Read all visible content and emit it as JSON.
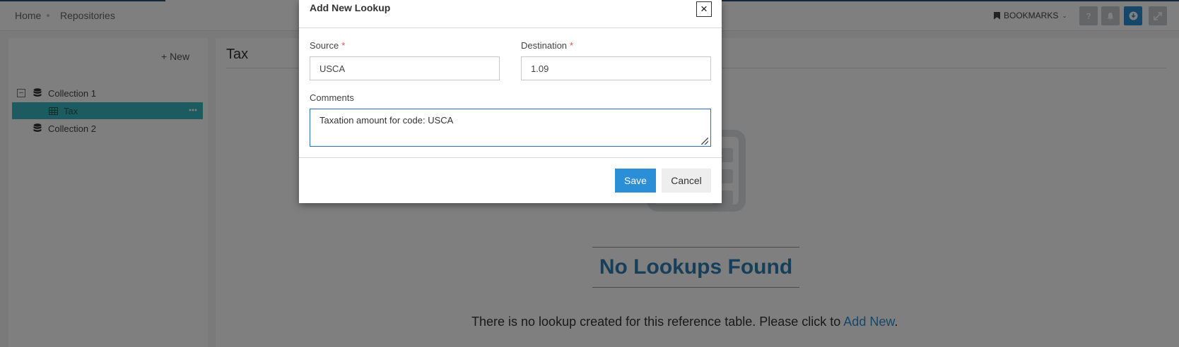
{
  "breadcrumb": {
    "home": "Home",
    "repositories": "Repositories"
  },
  "header": {
    "bookmarks_label": "BOOKMARKS",
    "help_glyph": "?"
  },
  "sidebar": {
    "new_label": "+ New",
    "tree": [
      {
        "label": "Collection 1",
        "expanded": true
      },
      {
        "label": "Tax",
        "selected": true
      },
      {
        "label": "Collection 2"
      }
    ]
  },
  "main": {
    "title": "Tax",
    "empty_title": "No Lookups Found",
    "empty_text": "There is no lookup created for this reference table. Please click to",
    "empty_link": "Add New",
    "empty_end": "."
  },
  "modal": {
    "title": "Add New Lookup",
    "close_glyph": "×",
    "source_label": "Source",
    "source_value": "USCA",
    "destination_label": "Destination",
    "destination_value": "1.09",
    "required_mark": "*",
    "comments_label": "Comments",
    "comments_value": "Taxation amount for code: USCA",
    "save_label": "Save",
    "cancel_label": "Cancel"
  },
  "colors": {
    "accent": "#2a8fd6",
    "selected_row": "#39b6bf",
    "empty_title": "#2f7fb5",
    "required": "#d9534f"
  },
  "icons": [
    "bookmark-icon",
    "chevron-down-icon",
    "help-icon",
    "bell-icon",
    "download-icon",
    "expand-icon",
    "database-icon",
    "table-icon",
    "more-icon",
    "close-icon"
  ]
}
